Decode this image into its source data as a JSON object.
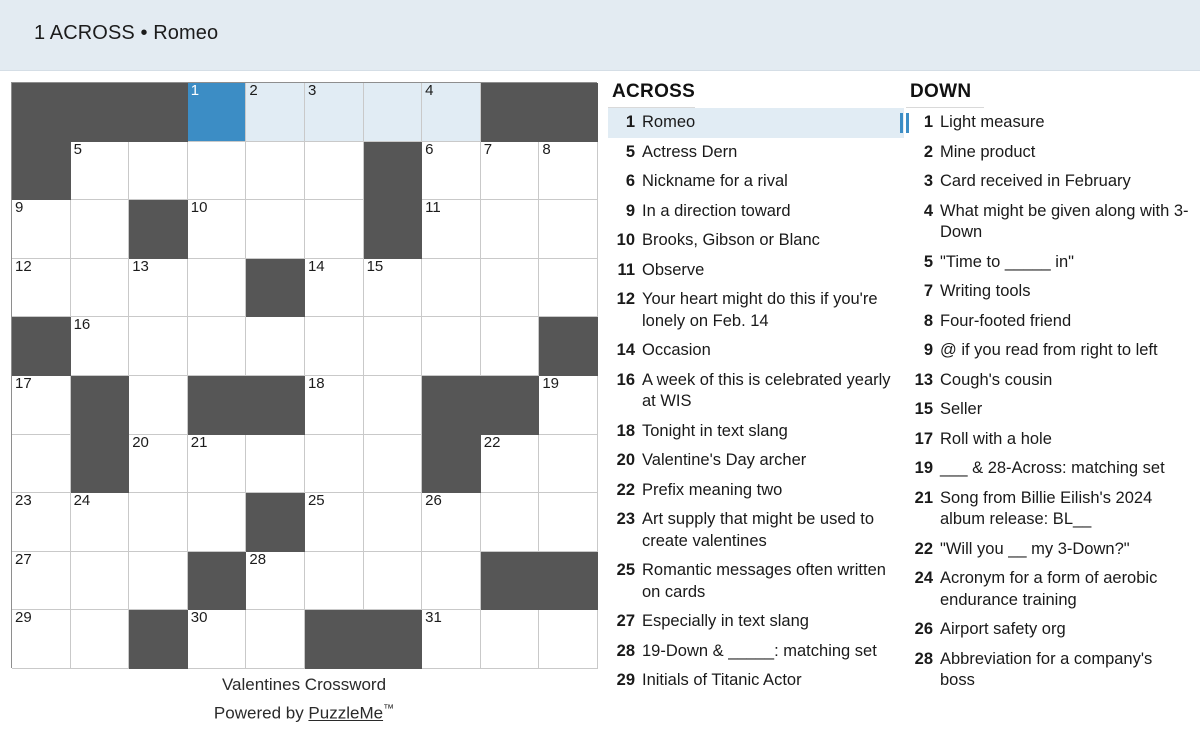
{
  "header": {
    "current_clue": "1 ACROSS • Romeo"
  },
  "grid": {
    "rows": 10,
    "cols": 10,
    "colors": {
      "block": "#565656",
      "cell": "#ffffff",
      "highlight": "#e1ecf4",
      "cursor": "#3c8dc5",
      "header_bar": "#e3ebf2"
    },
    "cells": [
      [
        {
          "block": true
        },
        {
          "block": true
        },
        {
          "block": true
        },
        {
          "num": "1",
          "state": "cursor"
        },
        {
          "num": "2",
          "state": "highlight"
        },
        {
          "num": "3",
          "state": "highlight"
        },
        {
          "state": "highlight"
        },
        {
          "num": "4",
          "state": "highlight"
        },
        {
          "block": true
        },
        {
          "block": true
        }
      ],
      [
        {
          "block": true
        },
        {
          "num": "5"
        },
        {},
        {},
        {},
        {},
        {
          "block": true
        },
        {
          "num": "6"
        },
        {
          "num": "7"
        },
        {
          "num": "8"
        }
      ],
      [
        {
          "num": "9"
        },
        {},
        {
          "block": true
        },
        {
          "num": "10"
        },
        {},
        {},
        {
          "block": true
        },
        {
          "num": "11"
        },
        {},
        {}
      ],
      [
        {
          "num": "12"
        },
        {},
        {
          "num": "13"
        },
        {},
        {
          "block": true
        },
        {
          "num": "14"
        },
        {
          "num": "15"
        },
        {},
        {},
        {}
      ],
      [
        {
          "block": true
        },
        {
          "num": "16"
        },
        {},
        {},
        {},
        {},
        {},
        {},
        {},
        {
          "block": true
        }
      ],
      [
        {
          "num": "17"
        },
        {
          "block": true
        },
        {},
        {
          "block": true
        },
        {
          "block": true
        },
        {
          "num": "18"
        },
        {},
        {
          "block": true
        },
        {
          "block": true
        },
        {
          "num": "19"
        }
      ],
      [
        {},
        {
          "block": true
        },
        {
          "num": "20"
        },
        {
          "num": "21"
        },
        {},
        {},
        {},
        {
          "block": true
        },
        {
          "num": "22"
        },
        {}
      ],
      [
        {
          "num": "23"
        },
        {
          "num": "24"
        },
        {},
        {},
        {
          "block": true
        },
        {
          "num": "25"
        },
        {},
        {
          "num": "26"
        },
        {},
        {}
      ],
      [
        {
          "num": "27"
        },
        {},
        {},
        {
          "block": true
        },
        {
          "num": "28"
        },
        {},
        {},
        {},
        {
          "block": true
        },
        {
          "block": true
        }
      ],
      [
        {
          "num": "29"
        },
        {},
        {
          "block": true
        },
        {
          "num": "30"
        },
        {},
        {
          "block": true
        },
        {
          "block": true
        },
        {
          "num": "31"
        },
        {},
        {}
      ]
    ]
  },
  "grid_footer": {
    "title": "Valentines Crossword",
    "powered_prefix": "Powered by ",
    "powered_link": "PuzzleMe",
    "trademark": "™"
  },
  "across": {
    "title": "ACROSS",
    "clues": [
      {
        "num": "1",
        "text": "Romeo",
        "active": true,
        "cursor": true
      },
      {
        "num": "5",
        "text": "Actress Dern"
      },
      {
        "num": "6",
        "text": "Nickname for a rival"
      },
      {
        "num": "9",
        "text": "In a direction toward"
      },
      {
        "num": "10",
        "text": "Brooks, Gibson or Blanc"
      },
      {
        "num": "11",
        "text": "Observe"
      },
      {
        "num": "12",
        "text": "Your heart might do this if you're lonely on Feb. 14"
      },
      {
        "num": "14",
        "text": "Occasion"
      },
      {
        "num": "16",
        "text": "A week of this is celebrated yearly at WIS"
      },
      {
        "num": "18",
        "text": "Tonight in text slang"
      },
      {
        "num": "20",
        "text": "Valentine's Day archer"
      },
      {
        "num": "22",
        "text": "Prefix meaning two"
      },
      {
        "num": "23",
        "text": "Art supply that might be used to create valentines"
      },
      {
        "num": "25",
        "text": "Romantic messages often written on cards"
      },
      {
        "num": "27",
        "text": "Especially in text slang"
      },
      {
        "num": "28",
        "text": "19-Down & _____: matching set"
      },
      {
        "num": "29",
        "text": "Initials of Titanic Actor"
      }
    ]
  },
  "down": {
    "title": "DOWN",
    "clues": [
      {
        "num": "1",
        "text": "Light measure",
        "cursor": true
      },
      {
        "num": "2",
        "text": "Mine product"
      },
      {
        "num": "3",
        "text": "Card received in February"
      },
      {
        "num": "4",
        "text": "What might be given along with 3-Down"
      },
      {
        "num": "5",
        "text": "\"Time to _____ in\""
      },
      {
        "num": "7",
        "text": "Writing tools"
      },
      {
        "num": "8",
        "text": "Four-footed friend"
      },
      {
        "num": "9",
        "text": "@ if you read from right to left"
      },
      {
        "num": "13",
        "text": "Cough's cousin"
      },
      {
        "num": "15",
        "text": "Seller"
      },
      {
        "num": "17",
        "text": "Roll with a hole"
      },
      {
        "num": "19",
        "text": "___ & 28-Across: matching set"
      },
      {
        "num": "21",
        "text": "Song from Billie Eilish's 2024 album release: BL__"
      },
      {
        "num": "22",
        "text": "\"Will you __ my 3-Down?\""
      },
      {
        "num": "24",
        "text": "Acronym for a form of aerobic endurance training"
      },
      {
        "num": "26",
        "text": "Airport safety org"
      },
      {
        "num": "28",
        "text": "Abbreviation for a company's boss"
      }
    ]
  }
}
